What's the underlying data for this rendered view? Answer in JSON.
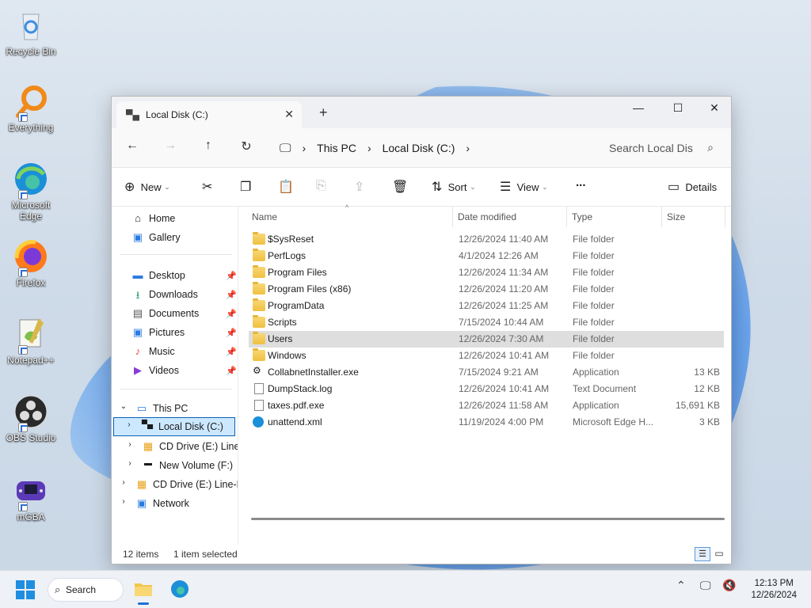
{
  "desktop": {
    "icons": [
      {
        "label": "Recycle Bin",
        "icon": "recycle-bin-icon"
      },
      {
        "label": "Everything",
        "icon": "everything-icon"
      },
      {
        "label": "Microsoft Edge",
        "icon": "edge-icon"
      },
      {
        "label": "Firefox",
        "icon": "firefox-icon"
      },
      {
        "label": "Notepad++",
        "icon": "notepadpp-icon"
      },
      {
        "label": "OBS Studio",
        "icon": "obs-icon"
      },
      {
        "label": "mGBA",
        "icon": "mgba-icon"
      }
    ]
  },
  "window": {
    "tab_title": "Local Disk (C:)",
    "breadcrumb": [
      "This PC",
      "Local Disk (C:)"
    ],
    "search_placeholder": "Search Local Dis",
    "toolbar": {
      "new_label": "New",
      "sort_label": "Sort",
      "view_label": "View",
      "more_label": "...",
      "details_label": "Details"
    }
  },
  "nav": {
    "quick": [
      "Home",
      "Gallery"
    ],
    "pinned": [
      "Desktop",
      "Downloads",
      "Documents",
      "Pictures",
      "Music",
      "Videos"
    ],
    "this_pc": "This PC",
    "drives": [
      "Local Disk (C:)",
      "CD Drive (E:) Line-E",
      "New Volume (F:)"
    ],
    "cd_drive": "CD Drive (E:) Line-Ed",
    "network": "Network"
  },
  "columns": {
    "name": "Name",
    "date": "Date modified",
    "type": "Type",
    "size": "Size"
  },
  "files": [
    {
      "name": "$SysReset",
      "date": "12/26/2024 11:40 AM",
      "type": "File folder",
      "size": "",
      "kind": "folder"
    },
    {
      "name": "PerfLogs",
      "date": "4/1/2024 12:26 AM",
      "type": "File folder",
      "size": "",
      "kind": "folder"
    },
    {
      "name": "Program Files",
      "date": "12/26/2024 11:34 AM",
      "type": "File folder",
      "size": "",
      "kind": "folder"
    },
    {
      "name": "Program Files (x86)",
      "date": "12/26/2024 11:20 AM",
      "type": "File folder",
      "size": "",
      "kind": "folder"
    },
    {
      "name": "ProgramData",
      "date": "12/26/2024 11:25 AM",
      "type": "File folder",
      "size": "",
      "kind": "folder"
    },
    {
      "name": "Scripts",
      "date": "7/15/2024 10:44 AM",
      "type": "File folder",
      "size": "",
      "kind": "folder"
    },
    {
      "name": "Users",
      "date": "12/26/2024 7:30 AM",
      "type": "File folder",
      "size": "",
      "kind": "folder"
    },
    {
      "name": "Windows",
      "date": "12/26/2024 10:41 AM",
      "type": "File folder",
      "size": "",
      "kind": "folder"
    },
    {
      "name": "CollabnetInstaller.exe",
      "date": "7/15/2024 9:21 AM",
      "type": "Application",
      "size": "13 KB",
      "kind": "exe"
    },
    {
      "name": "DumpStack.log",
      "date": "12/26/2024 10:41 AM",
      "type": "Text Document",
      "size": "12 KB",
      "kind": "doc"
    },
    {
      "name": "taxes.pdf.exe",
      "date": "12/26/2024 11:58 AM",
      "type": "Application",
      "size": "15,691 KB",
      "kind": "doc"
    },
    {
      "name": "unattend.xml",
      "date": "11/19/2024 4:00 PM",
      "type": "Microsoft Edge H...",
      "size": "3 KB",
      "kind": "edge"
    }
  ],
  "status": {
    "count": "12 items",
    "selected": "1 item selected"
  },
  "taskbar": {
    "search_label": "Search",
    "time": "12:13 PM",
    "date": "12/26/2024"
  }
}
